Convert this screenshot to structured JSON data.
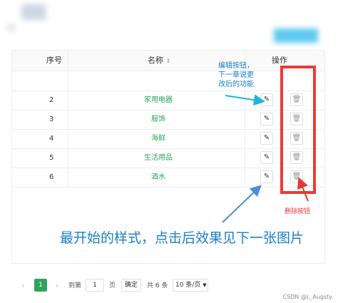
{
  "table": {
    "headers": {
      "seq": "序号",
      "name": "名称",
      "sort_icon": "sort-icon",
      "actions": "操作"
    },
    "rows": [
      {
        "seq": "",
        "name": ""
      },
      {
        "seq": "2",
        "name": "家用电器"
      },
      {
        "seq": "3",
        "name": "服饰"
      },
      {
        "seq": "4",
        "name": "海鲜"
      },
      {
        "seq": "5",
        "name": "生活用品"
      },
      {
        "seq": "6",
        "name": "酒水"
      }
    ],
    "name_color": "#2fa35e"
  },
  "annotations": {
    "edit_note": "编辑按钮，下一章说更改后的功能",
    "delete_note": "删除按钮",
    "main_note": "最开始的样式，点击后效果见下一张图片",
    "note_color": "#1a7fc8",
    "delete_color": "#e53935",
    "arrow_color": "#1fb6d6"
  },
  "pagination": {
    "current": "1",
    "goto_label": "到第",
    "goto_value": "1",
    "page_unit": "页",
    "confirm": "确定",
    "total": "共 6 条",
    "page_size": "10 条/页",
    "accent": "#2fa35e"
  },
  "watermark": "CSDN @L_Augsty"
}
